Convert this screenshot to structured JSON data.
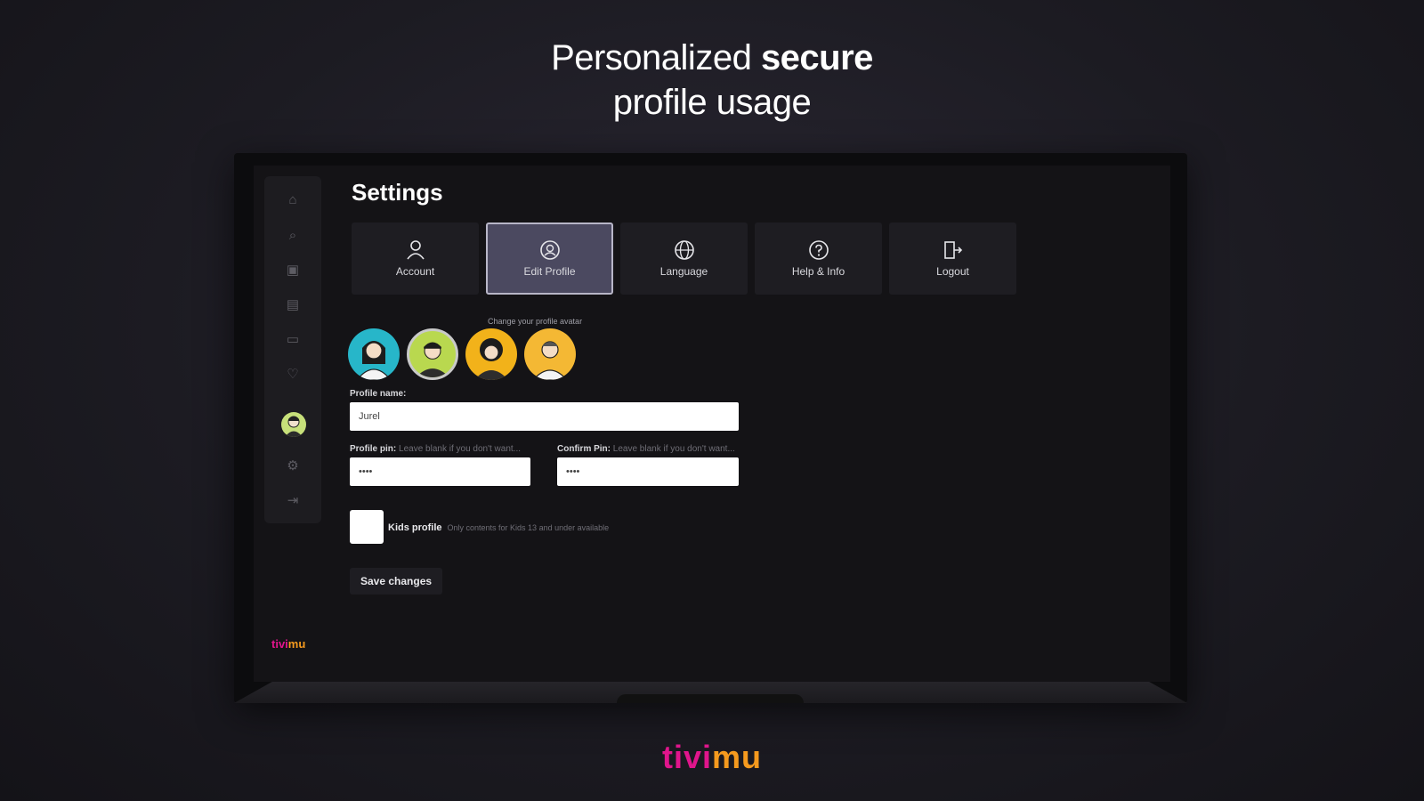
{
  "headline": {
    "line1_regular": "Personalized ",
    "line1_bold": "secure",
    "line2": "profile usage"
  },
  "sidebar": {
    "items": [
      {
        "icon": "home-icon",
        "glyph": "⌂"
      },
      {
        "icon": "search-icon",
        "glyph": "⌕"
      },
      {
        "icon": "tv-icon",
        "glyph": "▣"
      },
      {
        "icon": "movies-icon",
        "glyph": "▤"
      },
      {
        "icon": "series-icon",
        "glyph": "▭"
      },
      {
        "icon": "favorites-icon",
        "glyph": "♡"
      },
      {
        "icon": "settings-icon",
        "glyph": "⚙"
      },
      {
        "icon": "logout-icon",
        "glyph": "⇥"
      }
    ],
    "brand_left": "tivi",
    "brand_right": "mu"
  },
  "settings": {
    "title": "Settings",
    "tabs": [
      {
        "label": "Account",
        "icon": "user-icon",
        "glyph": "👤",
        "active": false
      },
      {
        "label": "Edit Profile",
        "icon": "edit-profile-icon",
        "glyph": "◎",
        "active": true
      },
      {
        "label": "Language",
        "icon": "globe-icon",
        "glyph": "⊕",
        "active": false
      },
      {
        "label": "Help & Info",
        "icon": "help-icon",
        "glyph": "?",
        "active": false
      },
      {
        "label": "Logout",
        "icon": "logout-icon",
        "glyph": "⇥",
        "active": false
      }
    ],
    "avatar_caption": "Change your profile avatar",
    "avatars": [
      {
        "name": "avatar-1",
        "color": "#27b6c9",
        "selected": false
      },
      {
        "name": "avatar-2",
        "color": "#b9d84f",
        "selected": true
      },
      {
        "name": "avatar-3",
        "color": "#f2b21a",
        "selected": false
      },
      {
        "name": "avatar-4",
        "color": "#f4b834",
        "selected": false
      }
    ],
    "profile_name_label": "Profile name:",
    "profile_name_value": "Jurel",
    "profile_pin_label": "Profile pin:",
    "profile_pin_hint": "Leave blank if you don't want...",
    "profile_pin_value": "••••",
    "confirm_pin_label": "Confirm Pin:",
    "confirm_pin_hint": "Leave blank if you don't want...",
    "confirm_pin_value": "••••",
    "kids_label": "Kids profile",
    "kids_hint": "Only contents for Kids 13 and under available",
    "save_label": "Save changes"
  },
  "footer": {
    "brand_left": "tivi",
    "brand_right": "mu"
  },
  "colors": {
    "accent_pink": "#e0158c",
    "accent_orange": "#f59a1e",
    "active_tab": "#4b4960"
  }
}
